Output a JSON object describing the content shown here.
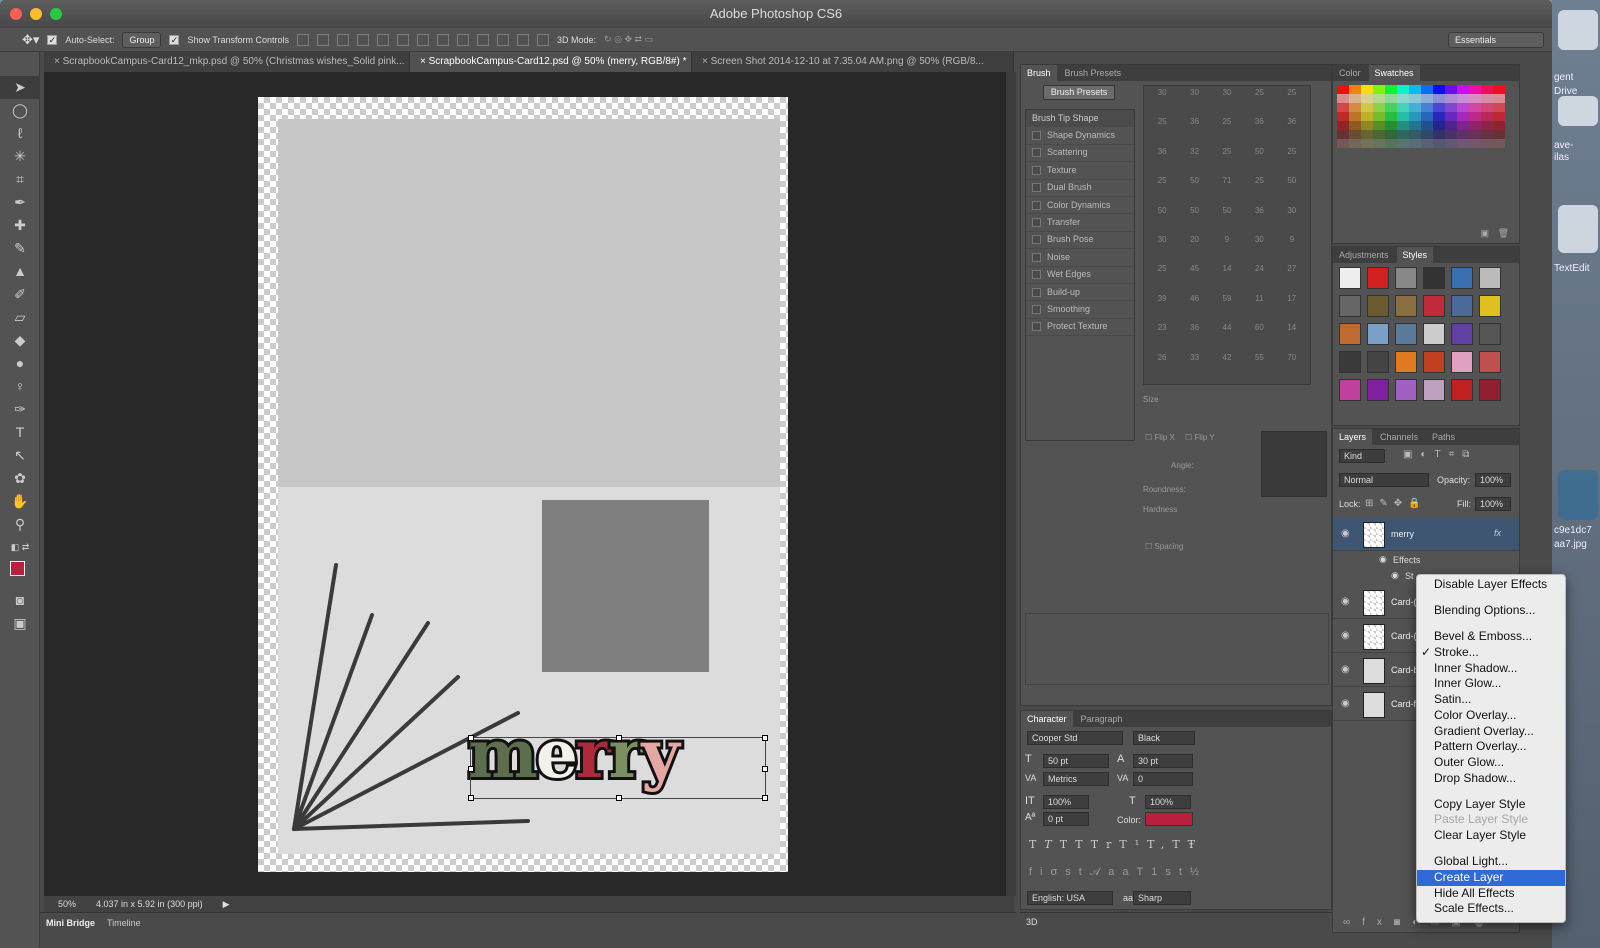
{
  "window": {
    "title": "Adobe Photoshop CS6",
    "workspace": "Essentials"
  },
  "options": {
    "auto_select_label": "Auto-Select:",
    "auto_select_value": "Group",
    "show_transform_label": "Show Transform Controls",
    "mode_3d_label": "3D Mode:"
  },
  "doc_tabs": [
    "ScrapbookCampus-Card12_mkp.psd @ 50% (Christmas wishes_Solid pink...",
    "ScrapbookCampus-Card12.psd @ 50% (merry, RGB/8#) *",
    "Screen Shot 2014-12-10 at 7.35.04 AM.png @ 50% (RGB/8..."
  ],
  "canvas": {
    "text_m": "m",
    "text_e": "e",
    "text_r1": "r",
    "text_r2": "r",
    "text_y": "y",
    "colors": {
      "m": "#5d6e4e",
      "e": "#f3f1ea",
      "r1": "#b0283e",
      "r2": "#7c8f60",
      "y": "#e6a6a2"
    }
  },
  "status": {
    "zoom": "50%",
    "doc_size": "4.037 in x 5.92 in (300 ppi)"
  },
  "bottom_tabs": {
    "mini_bridge": "Mini Bridge",
    "timeline": "Timeline",
    "threed": "3D"
  },
  "brush": {
    "tabs": [
      "Brush",
      "Brush Presets"
    ],
    "presets_button": "Brush Presets",
    "tip_shape": "Brush Tip Shape",
    "options": [
      "Shape Dynamics",
      "Scattering",
      "Texture",
      "Dual Brush",
      "Color Dynamics",
      "Transfer",
      "Brush Pose",
      "Noise",
      "Wet Edges",
      "Build-up",
      "Smoothing",
      "Protect Texture"
    ],
    "tip_numbers": [
      "30",
      "30",
      "30",
      "25",
      "25",
      "25",
      "36",
      "25",
      "36",
      "36",
      "36",
      "32",
      "25",
      "50",
      "25",
      "25",
      "50",
      "71",
      "25",
      "50",
      "50",
      "50",
      "50",
      "36",
      "30",
      "30",
      "20",
      "9",
      "30",
      "9",
      "25",
      "45",
      "14",
      "24",
      "27",
      "39",
      "46",
      "59",
      "11",
      "17",
      "23",
      "36",
      "44",
      "60",
      "14",
      "26",
      "33",
      "42",
      "55",
      "70"
    ],
    "size_label": "Size",
    "flip_x": "Flip X",
    "flip_y": "Flip Y",
    "angle": "Angle:",
    "roundness": "Roundness:",
    "hardness": "Hardness",
    "spacing": "Spacing"
  },
  "character": {
    "tabs": [
      "Character",
      "Paragraph"
    ],
    "font": "Cooper Std",
    "style": "Black",
    "size": "50 pt",
    "leading": "30 pt",
    "kerning": "Metrics",
    "tracking": "0",
    "vscale": "100%",
    "hscale": "100%",
    "baseline": "0 pt",
    "color_label": "Color:",
    "color": "#b8203c",
    "language": "English: USA",
    "antialias_label": "aa",
    "antialias": "Sharp"
  },
  "color_panel": {
    "tabs": [
      "Color",
      "Swatches"
    ]
  },
  "styles_panel": {
    "tabs": [
      "Adjustments",
      "Styles"
    ]
  },
  "layers": {
    "tabs": [
      "Layers",
      "Channels",
      "Paths"
    ],
    "kind": "Kind",
    "blend": "Normal",
    "opacity_label": "Opacity:",
    "opacity": "100%",
    "lock_label": "Lock:",
    "fill_label": "Fill:",
    "fill": "100%",
    "rows": [
      {
        "name": "merry",
        "fx": "fx"
      },
      {
        "name": "Effects"
      },
      {
        "name": "St"
      },
      {
        "name": "Card-("
      },
      {
        "name": "Card-("
      },
      {
        "name": "Card-b"
      },
      {
        "name": "Card-f"
      }
    ]
  },
  "context_menu": {
    "items": [
      "Disable Layer Effects",
      "Blending Options...",
      "Bevel & Emboss...",
      "Stroke...",
      "Inner Shadow...",
      "Inner Glow...",
      "Satin...",
      "Color Overlay...",
      "Gradient Overlay...",
      "Pattern Overlay...",
      "Outer Glow...",
      "Drop Shadow...",
      "Copy Layer Style",
      "Paste Layer Style",
      "Clear Layer Style",
      "Global Light...",
      "Create Layer",
      "Hide All Effects",
      "Scale Effects..."
    ],
    "checked": "Stroke...",
    "highlighted": "Create Layer",
    "disabled": "Paste Layer Style"
  },
  "desktop": {
    "label1": "gent",
    "label2": "Drive",
    "label3": "ave-",
    "label4": "ilas",
    "label5": "TextEdit",
    "label6": "c9e1dc7",
    "label7": "aa7.jpg"
  }
}
